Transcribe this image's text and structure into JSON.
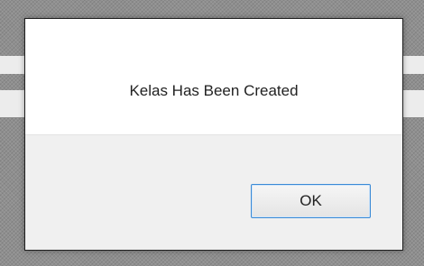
{
  "dialog": {
    "message": "Kelas Has Been Created",
    "ok_label": "OK"
  },
  "colors": {
    "overlay": "#8f8f8f",
    "dialog_body": "#ffffff",
    "dialog_footer": "#f0f0f0",
    "button_border": "#3b8ad6"
  }
}
